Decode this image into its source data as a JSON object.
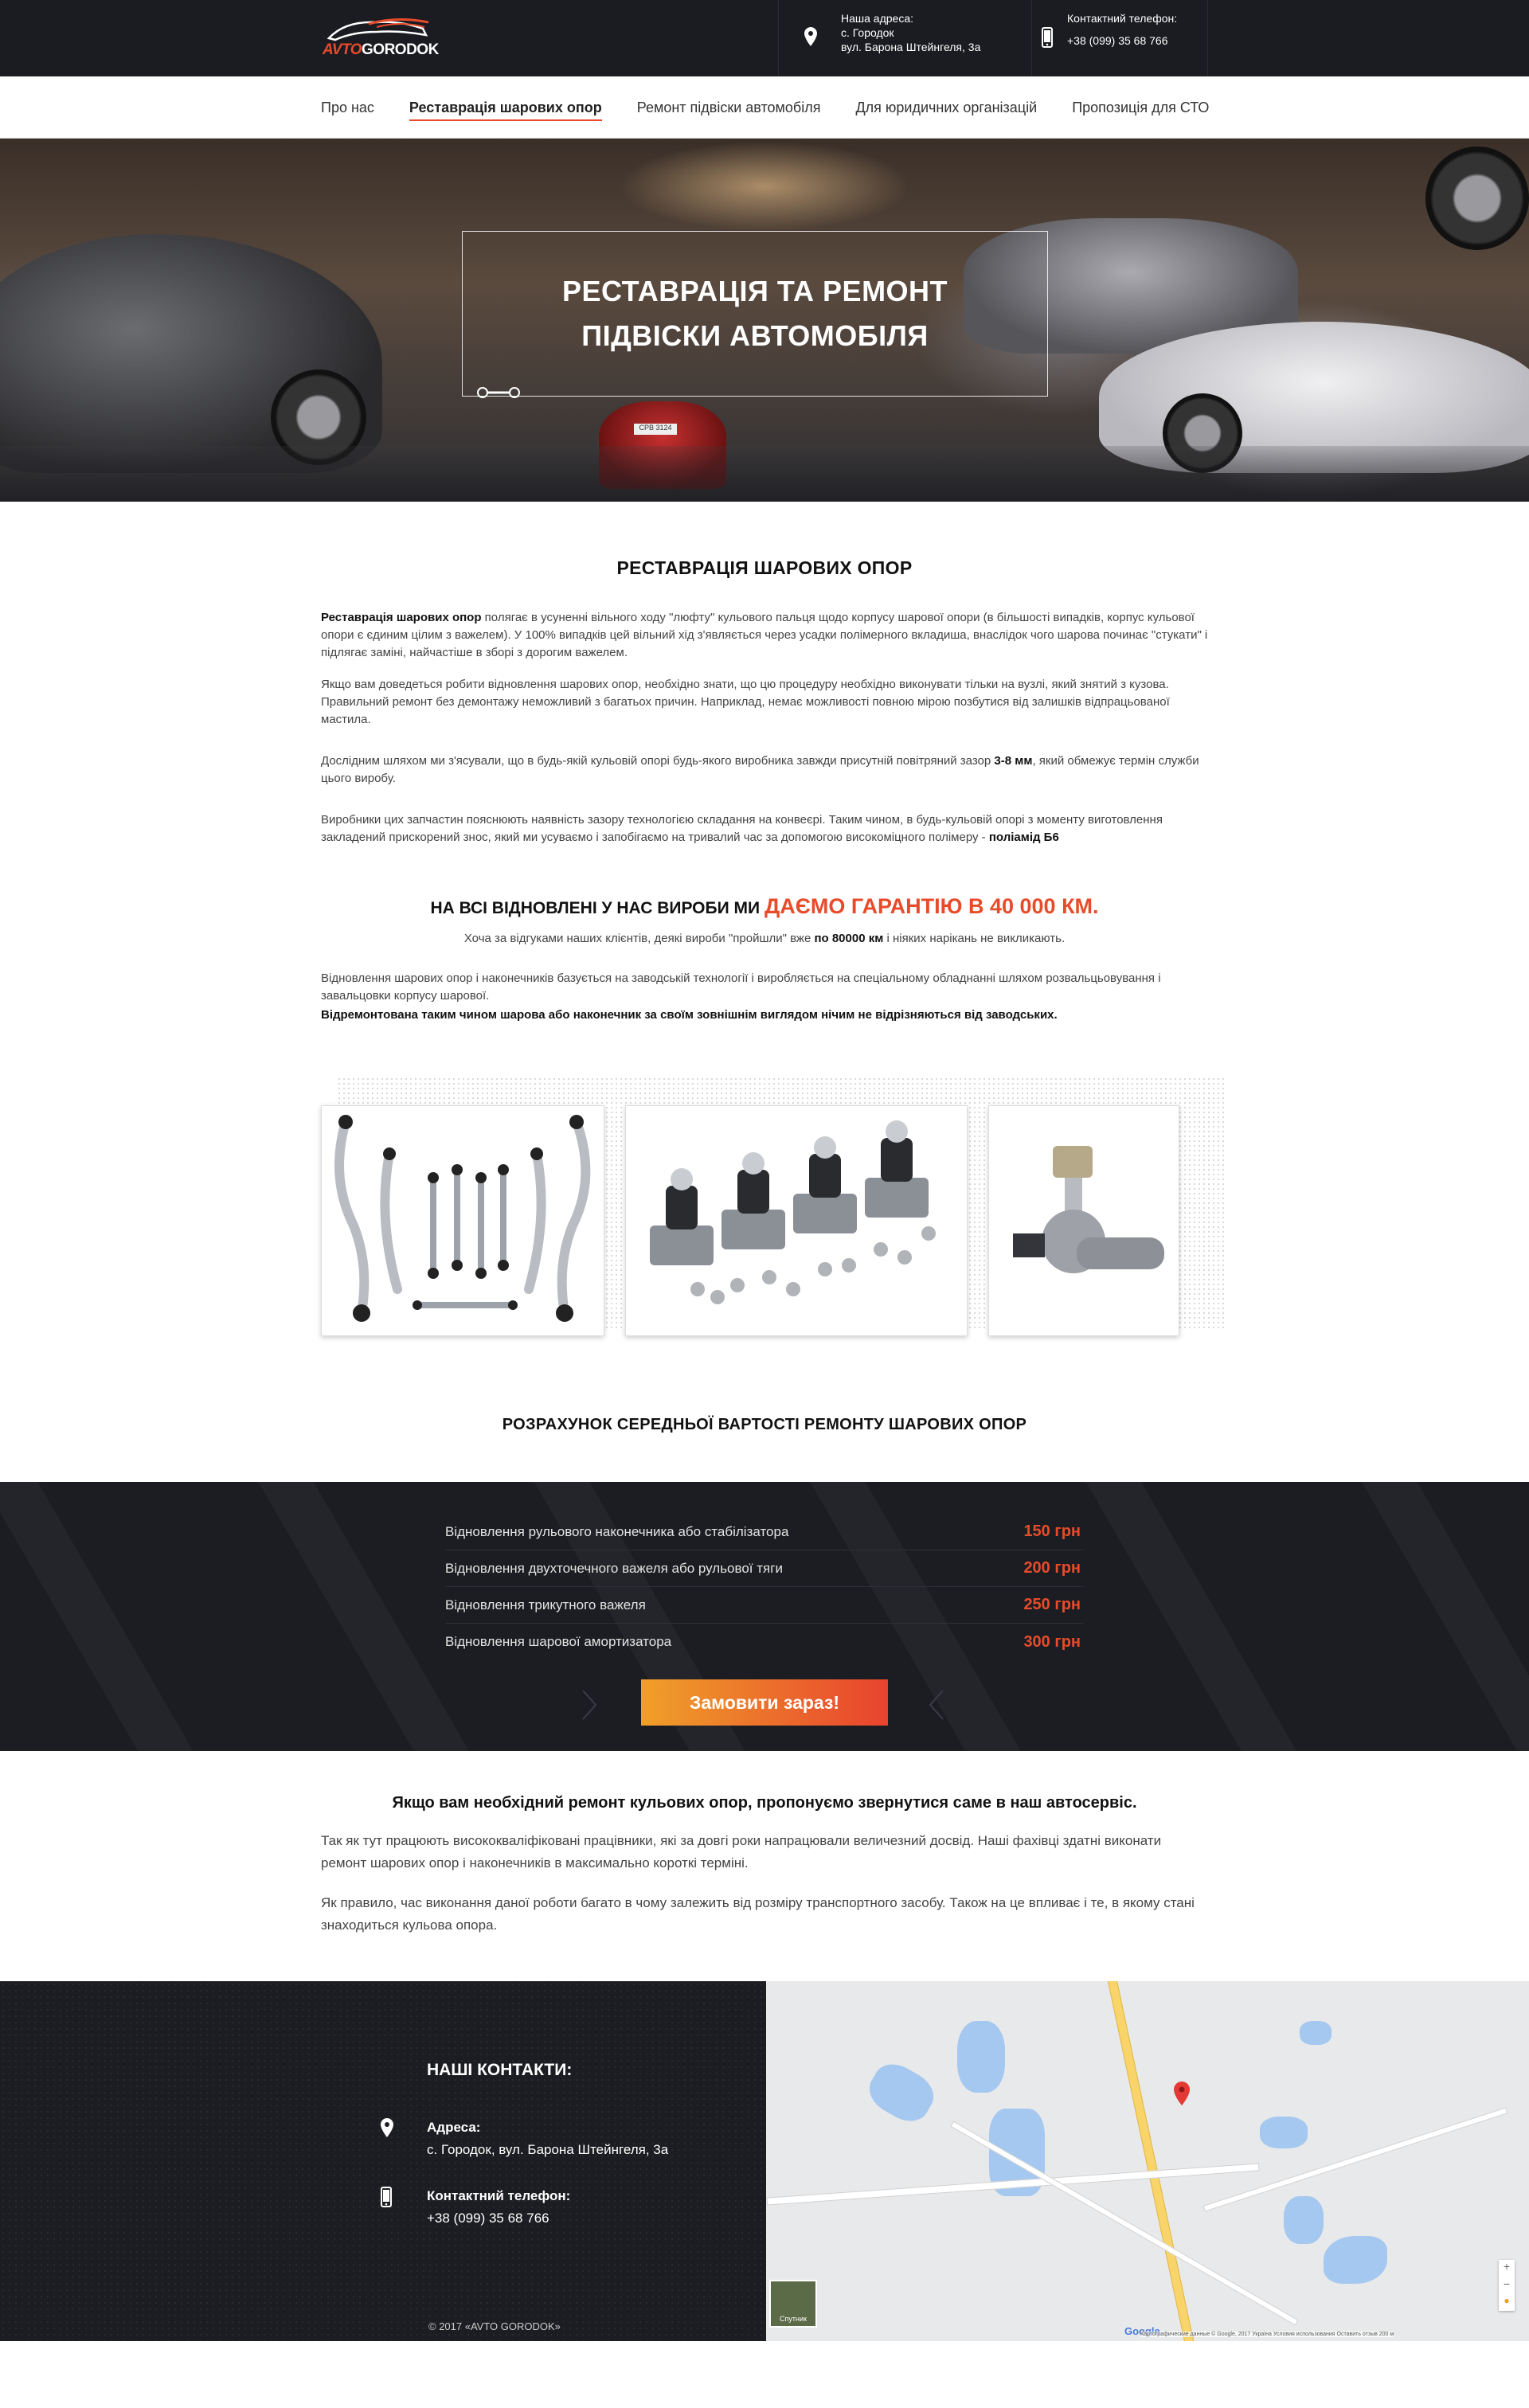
{
  "header": {
    "logo_word_1": "AVTO",
    "logo_word_2": "GORODOK",
    "address_label": "Наша адреса:",
    "address_line1": "с. Городок",
    "address_line2": "вул. Барона Штейнгеля, 3а",
    "phone_label": "Контактний телефон:",
    "phone_value": "+38 (099) 35 68 766"
  },
  "nav": {
    "items": [
      {
        "label": "Про нас"
      },
      {
        "label": "Реставрація шарових опор"
      },
      {
        "label": "Ремонт підвіски автомобіля"
      },
      {
        "label": "Для юридичних організацій"
      },
      {
        "label": "Пропозиція для СТО"
      }
    ],
    "active_index": 1
  },
  "hero": {
    "title": "РЕСТАВРАЦІЯ ТА РЕМОНТ ПІДВІСКИ АВТОМОБІЛЯ",
    "plate_text": "CPB 3124"
  },
  "section1": {
    "title": "РЕСТАВРАЦІЯ ШАРОВИХ ОПОР",
    "p1_bold": "Реставрація шарових  опор",
    "p1_text": " полягає в усуненні вільного ходу \"люфту\" кульового пальця щодо корпусу шарової опори (в більшості випадків, корпус кульової опори є єдиним цілим з важелем). У 100% випадків цей вільний хід з'являється через усадки полімерного вкладиша, внаслідок чого шарова починає \"стукати\" і підлягає заміні, найчастіше в зборі з дорогим важелем.",
    "p2": "Якщо вам доведеться робити відновлення шарових опор, необхідно знати, що цю процедуру необхідно виконувати тільки на вузлі, який знятий з кузова. Правильний ремонт без демонтажу неможливий з багатьох причин. Наприклад, немає можливості повною мірою позбутися від залишків відпрацьованої мастила.",
    "p3_before": "Дослідним шляхом ми з'ясували, що в будь-якій кульовій опорі будь-якого виробника завжди присутній повітряний зазор ",
    "p3_bold": "3-8 мм",
    "p3_after": ", який обмежує термін служби цього виробу.",
    "p4_text": "Виробники цих запчастин пояснюють наявність зазору технологією складання на конвеєрі. Таким чином, в будь-кульовій опорі з моменту виготовлення закладений прискорений знос, який ми усуваємо і запобігаємо на тривалий час за допомогою високоміцного полімеру - ",
    "p4_bold": "поліамід Б6"
  },
  "guarantee": {
    "lead": "НА ВСІ ВІДНОВЛЕНІ У НАС ВИРОБИ МИ ",
    "accent": "ДАЄМО ГАРАНТІЮ В 40 000 КМ.",
    "sub_before": "Хоча за відгуками наших клієнтів, деякі вироби \"пройшли\" вже ",
    "sub_bold": "по 80000 км",
    "sub_after": " і ніяких нарікань не викликають.",
    "p1": "Відновлення шарових  опор і наконечників базується на заводській технології і виробляється на спеціальному обладнанні шляхом розвальцьовування і завальцовки корпусу шарової.",
    "p2_bold": "Відремонтована  таким чином шарова  або наконечник за своїм зовнішнім виглядом нічим не відрізняються від заводських."
  },
  "calc": {
    "title": "РОЗРАХУНОК СЕРЕДНЬОЇ ВАРТОСТІ РЕМОНТУ ШАРОВИХ ОПОР",
    "rows": [
      {
        "name": "Відновлення рульового наконечника або стабілізатора",
        "price": "150 грн"
      },
      {
        "name": "Відновлення двухточечного важеля або рульової тяги",
        "price": "200 грн"
      },
      {
        "name": "Відновлення трикутного важеля",
        "price": "250 грн"
      },
      {
        "name": "Відновлення шарової амортизатора",
        "price": "300 грн"
      }
    ],
    "order_label": "Замовити зараз!"
  },
  "after": {
    "title": "Якщо вам необхідний ремонт кульових опор, пропонуємо звернутися саме в наш автосервіс.",
    "p1": "Так як тут працюють висококваліфіковані працівники, які за довгі роки напрацювали величезний досвід. Наші фахівці здатні виконати ремонт шарових опор і наконечників в максимально короткі терміні.",
    "p2": " Як правило, час виконання даної роботи багато в чому залежить від розміру транспортного засобу. Також на це впливає і те, в якому стані знаходиться кульова опора."
  },
  "footer": {
    "title": "НАШІ КОНТАКТИ:",
    "address_label": "Адреса:",
    "address_value": "с. Городок, вул. Барона Штейнгеля, 3а",
    "phone_label": "Контактний телефон:",
    "phone_value": "+38 (099) 35 68 766",
    "copyright": "© 2017  «AVTO GORODOK»",
    "map_satellite": "Спутник",
    "map_google": "Google",
    "map_attrib": "Картографические данные © Google, 2017   Україна   Условия использования   Оставить отзыв   200 м"
  },
  "colors": {
    "accent": "#e84b2a",
    "dark": "#1c1d22",
    "button_from": "#f0a029",
    "button_to": "#e8432e"
  }
}
